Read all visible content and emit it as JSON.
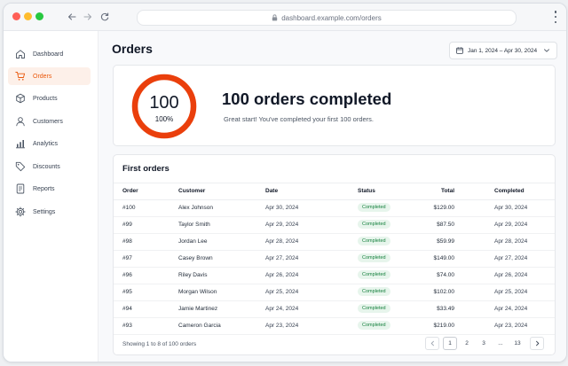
{
  "browser": {
    "url": "dashboard.example.com/orders"
  },
  "sidebar": {
    "items": [
      {
        "label": "Dashboard",
        "icon": "home-icon"
      },
      {
        "label": "Orders",
        "icon": "cart-icon",
        "active": true
      },
      {
        "label": "Products",
        "icon": "box-icon"
      },
      {
        "label": "Customers",
        "icon": "user-icon"
      },
      {
        "label": "Analytics",
        "icon": "bar-chart-icon"
      },
      {
        "label": "Discounts",
        "icon": "tag-icon"
      },
      {
        "label": "Reports",
        "icon": "document-icon"
      },
      {
        "label": "Settings",
        "icon": "gear-icon"
      }
    ]
  },
  "header": {
    "title": "Orders",
    "date_range": "Jan 1, 2024 – Apr 30, 2024"
  },
  "milestone": {
    "count": "100",
    "percent_label": "100%",
    "progress": 1.0,
    "title": "100 orders completed",
    "subtitle": "Great start! You've completed your first 100 orders."
  },
  "orders_table": {
    "title": "First orders",
    "columns": [
      "Order",
      "Customer",
      "Date",
      "Status",
      "Total",
      "Completed"
    ],
    "rows": [
      {
        "order": "#100",
        "customer": "Alex Johnson",
        "date": "Apr 30, 2024",
        "status": "Completed",
        "total": "$129.00",
        "completed": "Apr 30, 2024"
      },
      {
        "order": "#99",
        "customer": "Taylor Smith",
        "date": "Apr 29, 2024",
        "status": "Completed",
        "total": "$87.50",
        "completed": "Apr 29, 2024"
      },
      {
        "order": "#98",
        "customer": "Jordan Lee",
        "date": "Apr 28, 2024",
        "status": "Completed",
        "total": "$59.99",
        "completed": "Apr 28, 2024"
      },
      {
        "order": "#97",
        "customer": "Casey Brown",
        "date": "Apr 27, 2024",
        "status": "Completed",
        "total": "$149.00",
        "completed": "Apr 27, 2024"
      },
      {
        "order": "#96",
        "customer": "Riley Davis",
        "date": "Apr 26, 2024",
        "status": "Completed",
        "total": "$74.00",
        "completed": "Apr 26, 2024"
      },
      {
        "order": "#95",
        "customer": "Morgan Wilson",
        "date": "Apr 25, 2024",
        "status": "Completed",
        "total": "$102.00",
        "completed": "Apr 25, 2024"
      },
      {
        "order": "#94",
        "customer": "Jamie Martinez",
        "date": "Apr 24, 2024",
        "status": "Completed",
        "total": "$33.49",
        "completed": "Apr 24, 2024"
      },
      {
        "order": "#93",
        "customer": "Cameron Garcia",
        "date": "Apr 23, 2024",
        "status": "Completed",
        "total": "$219.00",
        "completed": "Apr 23, 2024"
      }
    ],
    "footer_text": "Showing 1 to 8 of 100 orders",
    "pagination": {
      "pages": [
        "1",
        "2",
        "3",
        "...",
        "13"
      ],
      "current": "1"
    }
  },
  "colors": {
    "accent": "#ea580c",
    "ring": "#ea3f0c",
    "status_bg": "#e7f5ec",
    "status_text": "#15803d"
  }
}
